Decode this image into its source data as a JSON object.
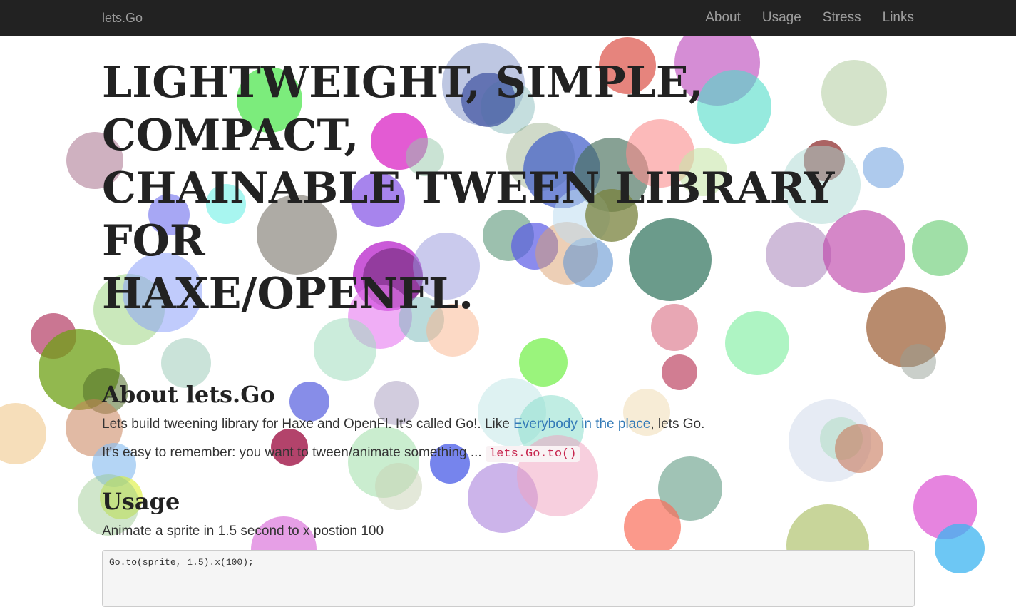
{
  "navbar": {
    "brand": "lets.Go",
    "links": [
      "About",
      "Usage",
      "Stress",
      "Links"
    ]
  },
  "hero": {
    "line1": "LIGHTWEIGHT, SIMPLE, COMPACT,",
    "line2": "CHAINABLE TWEEN LIBRARY FOR",
    "line3": "HAXE/OPENFL."
  },
  "about": {
    "heading": "About lets.Go",
    "p1_before": "Lets build tweening library for Haxe and OpenFl. It's called Go!. Like ",
    "p1_link": "Everybody in the place",
    "p1_after": ", lets Go.",
    "p2_before": "It's easy to remember: you want to tween/animate something ... ",
    "p2_code": "lets.Go.to()"
  },
  "usage": {
    "heading": "Usage",
    "p1": "Animate a sprite in 1.5 second to x postion 100",
    "code": "Go.to(sprite, 1.5).x(100);"
  },
  "colors": {
    "navbar": "#222222",
    "nav_text": "#9d9d9d",
    "link": "#337ab7",
    "code_text": "#c7254e"
  }
}
